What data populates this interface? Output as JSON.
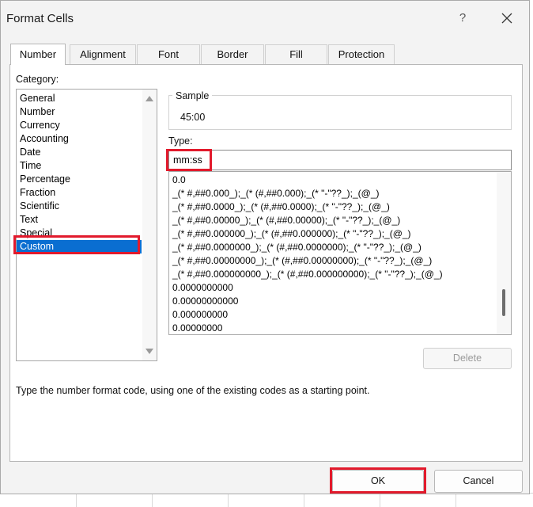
{
  "dialog": {
    "title": "Format Cells",
    "help": "?"
  },
  "tabs": [
    {
      "label": "Number"
    },
    {
      "label": "Alignment"
    },
    {
      "label": "Font"
    },
    {
      "label": "Border"
    },
    {
      "label": "Fill"
    },
    {
      "label": "Protection"
    }
  ],
  "active_tab": "Number",
  "category": {
    "label": "Category:",
    "items": [
      "General",
      "Number",
      "Currency",
      "Accounting",
      "Date",
      "Time",
      "Percentage",
      "Fraction",
      "Scientific",
      "Text",
      "Special",
      "Custom"
    ],
    "selected": "Custom"
  },
  "sample": {
    "label": "Sample",
    "value": "45:00"
  },
  "type": {
    "label": "Type:",
    "value": "mm:ss",
    "formats": [
      "0.0",
      "_(* #,##0.000_);_(* (#,##0.000);_(* \"-\"??_);_(@_)",
      "_(* #,##0.0000_);_(* (#,##0.0000);_(* \"-\"??_);_(@_)",
      "_(* #,##0.00000_);_(* (#,##0.00000);_(* \"-\"??_);_(@_)",
      "_(* #,##0.000000_);_(* (#,##0.000000);_(* \"-\"??_);_(@_)",
      "_(* #,##0.0000000_);_(* (#,##0.0000000);_(* \"-\"??_);_(@_)",
      "_(* #,##0.00000000_);_(* (#,##0.00000000);_(* \"-\"??_);_(@_)",
      "_(* #,##0.000000000_);_(* (#,##0.000000000);_(* \"-\"??_);_(@_)",
      "0.0000000000",
      "0.00000000000",
      "0.000000000",
      "0.00000000"
    ]
  },
  "buttons": {
    "delete": "Delete",
    "ok": "OK",
    "cancel": "Cancel"
  },
  "hint": "Type the number format code, using one of the existing codes as a starting point.",
  "colors": {
    "selection": "#0a6ed1",
    "highlight": "#e21a2c"
  }
}
